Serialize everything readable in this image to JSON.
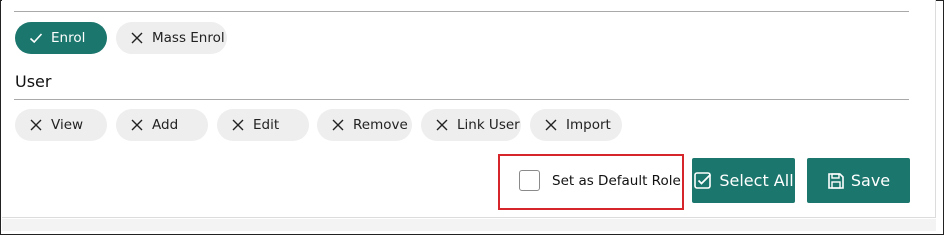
{
  "enrol_group": {
    "buttons": [
      {
        "label": "Enrol",
        "icon": "check-icon",
        "active": true
      },
      {
        "label": "Mass Enrol",
        "icon": "x-icon",
        "active": false
      }
    ]
  },
  "user_section": {
    "title": "User",
    "buttons": [
      {
        "label": "View",
        "icon": "x-icon"
      },
      {
        "label": "Add",
        "icon": "x-icon"
      },
      {
        "label": "Edit",
        "icon": "x-icon"
      },
      {
        "label": "Remove",
        "icon": "x-icon"
      },
      {
        "label": "Link User",
        "icon": "x-icon"
      },
      {
        "label": "Import",
        "icon": "x-icon"
      }
    ]
  },
  "footer": {
    "default_role_label": "Set as Default Role",
    "default_role_checked": false,
    "select_all_label": "Select All",
    "save_label": "Save"
  },
  "colors": {
    "accent": "#1b766d",
    "pill_bg": "#eeeeee",
    "highlight": "#d6262b"
  }
}
